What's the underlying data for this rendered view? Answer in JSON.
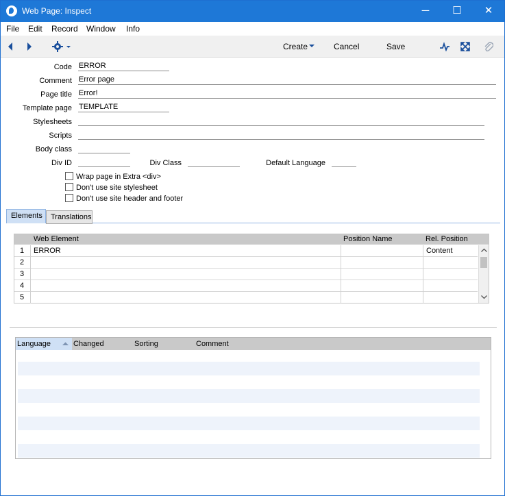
{
  "window": {
    "title": "Web Page: Inspect",
    "controls": {
      "minimize": "─",
      "maximize": "☐",
      "close": "✕"
    }
  },
  "menu": [
    "File",
    "Edit",
    "Record",
    "Window",
    "Info"
  ],
  "toolbar": {
    "create_label": "Create",
    "cancel_label": "Cancel",
    "save_label": "Save"
  },
  "form": {
    "code": {
      "label": "Code",
      "value": "ERROR"
    },
    "comment": {
      "label": "Comment",
      "value": "Error page"
    },
    "page_title": {
      "label": "Page title",
      "value": "Error!"
    },
    "template_page": {
      "label": "Template page",
      "value": "TEMPLATE"
    },
    "stylesheets": {
      "label": "Stylesheets",
      "value": ""
    },
    "scripts": {
      "label": "Scripts",
      "value": ""
    },
    "body_class": {
      "label": "Body class",
      "value": ""
    },
    "div_id": {
      "label": "Div ID",
      "value": ""
    },
    "div_class": {
      "label": "Div Class",
      "value": ""
    },
    "default_language": {
      "label": "Default Language",
      "value": ""
    },
    "checkboxes": [
      {
        "label": "Wrap page in Extra <div>",
        "checked": false
      },
      {
        "label": "Don't use site stylesheet",
        "checked": false
      },
      {
        "label": "Don't use site header and footer",
        "checked": false
      }
    ]
  },
  "tabs": [
    {
      "label": "Elements",
      "active": true
    },
    {
      "label": "Translations",
      "active": false
    }
  ],
  "elements_grid": {
    "columns": [
      "Web Element",
      "Position Name",
      "Rel. Position"
    ],
    "rows": [
      {
        "num": "1",
        "web_element": "ERROR",
        "position_name": "",
        "rel_position": "Content"
      },
      {
        "num": "2",
        "web_element": "",
        "position_name": "",
        "rel_position": ""
      },
      {
        "num": "3",
        "web_element": "",
        "position_name": "",
        "rel_position": ""
      },
      {
        "num": "4",
        "web_element": "",
        "position_name": "",
        "rel_position": ""
      },
      {
        "num": "5",
        "web_element": "",
        "position_name": "",
        "rel_position": ""
      }
    ]
  },
  "translations_list": {
    "columns": [
      "Language",
      "Changed",
      "Sorting",
      "Comment"
    ],
    "sorted_column": "Language"
  },
  "colors": {
    "titlebar": "#1e78d7",
    "accent": "#cfe0f5"
  }
}
